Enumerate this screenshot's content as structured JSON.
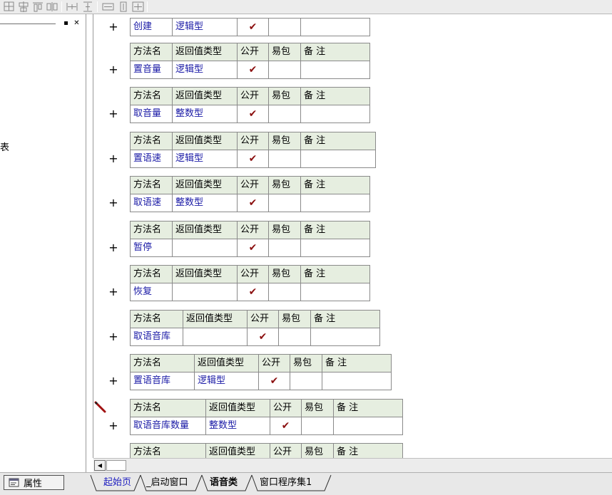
{
  "toolbar": {
    "buttons": [
      "grid-icon",
      "align-center-icon",
      "align-top-icon",
      "spacing-icon",
      "width-spacing-icon",
      "height-spacing-icon",
      "same-width-icon",
      "same-height-icon",
      "same-size-icon"
    ]
  },
  "left_panel": {
    "window_buttons": [
      "▪",
      "✕"
    ],
    "partial_text": "表"
  },
  "property_tab": {
    "label": "属性"
  },
  "method_table": {
    "headers": [
      "方法名",
      "返回值类型",
      "公开",
      "易包",
      "备 注"
    ],
    "check_mark": "✔",
    "plus": "+",
    "first_row": {
      "name": "创建",
      "type": "逻辑型",
      "public": true
    },
    "methods": [
      {
        "name": "置音量",
        "type": "逻辑型",
        "public": true
      },
      {
        "name": "取音量",
        "type": "整数型",
        "public": true
      },
      {
        "name": "置语速",
        "type": "逻辑型",
        "public": true
      },
      {
        "name": "取语速",
        "type": "整数型",
        "public": true
      },
      {
        "name": "暂停",
        "type": "",
        "public": true
      },
      {
        "name": "恢复",
        "type": "",
        "public": true
      },
      {
        "name": "取语音库",
        "type": "",
        "public": true
      },
      {
        "name": "置语音库",
        "type": "逻辑型",
        "public": true
      },
      {
        "name": "取语音库数量",
        "type": "整数型",
        "public": true
      }
    ]
  },
  "tabs": {
    "items": [
      "起始页",
      "_启动窗口",
      "语音类",
      "窗口程序集1"
    ],
    "active": "语音类"
  },
  "colors": {
    "header_bg": "#e6eee0",
    "link_text": "#1a1aa6",
    "check": "#8b1010",
    "start_tab": "#2020c0"
  }
}
